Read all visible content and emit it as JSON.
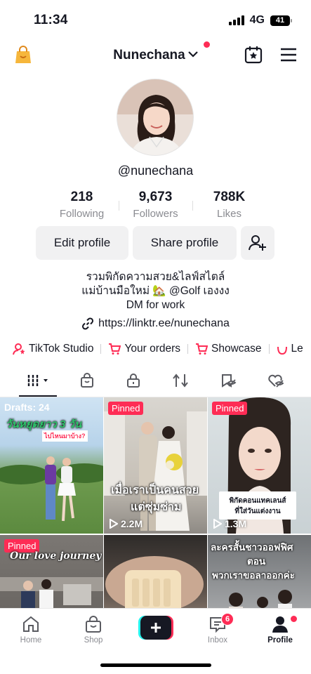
{
  "status": {
    "time": "11:34",
    "network": "4G",
    "battery": "41"
  },
  "header": {
    "username": "Nunechana"
  },
  "profile": {
    "handle": "@nunechana",
    "stats": [
      {
        "value": "218",
        "label": "Following"
      },
      {
        "value": "9,673",
        "label": "Followers"
      },
      {
        "value": "788K",
        "label": "Likes"
      }
    ],
    "edit_label": "Edit profile",
    "share_label": "Share profile",
    "bio_line1": "รวมพิกัดความสวย&ไลฟ์สไตล์",
    "bio_line2": "แม่บ้านมือใหม่ 🏡 @Golf เองงง",
    "bio_line3": "DM for work",
    "link": "https://linktr.ee/nunechana"
  },
  "quick_links": [
    {
      "label": "TikTok Studio",
      "icon": "studio-icon"
    },
    {
      "label": "Your orders",
      "icon": "cart-icon"
    },
    {
      "label": "Showcase",
      "icon": "cart-icon"
    },
    {
      "label": "Le",
      "icon": "smile-icon"
    }
  ],
  "tabs": [
    "videos-tab",
    "shop-tab",
    "private-tab",
    "reposts-tab",
    "favorites-tab",
    "liked-tab"
  ],
  "grid": [
    {
      "label": "Drafts: 24",
      "overlay": "วันหยุดยาว 3 วัน",
      "overlay2": "ไปไหนมาบ้าง?"
    },
    {
      "pinned": "Pinned",
      "overlay": "เมื่อเราเป็นคนสวย",
      "overlay2": "แต่ซุ่มซ่าม",
      "views": "2.2M"
    },
    {
      "pinned": "Pinned",
      "overlay": "พิกัดคอนแทคเลนส์",
      "overlay2": "ที่ใส่วันแต่งงาน",
      "views": "1.3M"
    },
    {
      "pinned": "Pinned",
      "overlay": "Our love journey"
    },
    {},
    {
      "overlay": "ละครสั้นชาวออฟฟิศ",
      "overlay2": "ตอน",
      "overlay3": "พวกเราขอลาออกค่ะ"
    }
  ],
  "bottom_nav": {
    "home": "Home",
    "shop": "Shop",
    "inbox": "Inbox",
    "inbox_badge": "6",
    "profile": "Profile"
  },
  "colors": {
    "accent": "#fe2c55",
    "text": "#161823",
    "muted": "#8a8b91"
  }
}
